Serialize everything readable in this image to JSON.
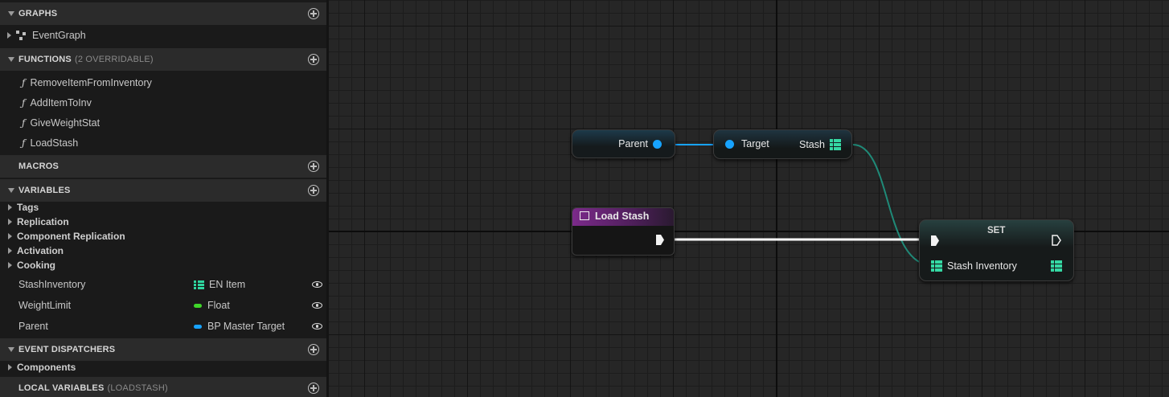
{
  "panel": {
    "graphs": {
      "title": "GRAPHS",
      "items": [
        "EventGraph"
      ]
    },
    "functions": {
      "title": "FUNCTIONS",
      "subtitle": "(2 OVERRIDABLE)",
      "items": [
        "RemoveItemFromInventory",
        "AddItemToInv",
        "GiveWeightStat",
        "LoadStash"
      ]
    },
    "macros": {
      "title": "MACROS"
    },
    "variables": {
      "title": "VARIABLES",
      "categories": [
        "Tags",
        "Replication",
        "Component Replication",
        "Activation",
        "Cooking"
      ],
      "items": [
        {
          "name": "StashInventory",
          "type": "EN Item",
          "type_icon": "array-grid-icon",
          "color": "#2fd7a0"
        },
        {
          "name": "WeightLimit",
          "type": "Float",
          "type_icon": "float-pill-icon",
          "color": "#3fd629"
        },
        {
          "name": "Parent",
          "type": "BP Master Target",
          "type_icon": "object-pill-icon",
          "color": "#17a3ff"
        }
      ]
    },
    "dispatchers": {
      "title": "EVENT DISPATCHERS",
      "items": [
        "Components"
      ]
    },
    "local_variables": {
      "title": "LOCAL VARIABLES",
      "subtitle": "(LOADSTASH)"
    }
  },
  "graph": {
    "nodes": {
      "parent_getter": {
        "pin": "Parent"
      },
      "stash_getter": {
        "input_pin": "Target",
        "output_pin": "Stash"
      },
      "load_stash_entry": {
        "title": "Load Stash",
        "header_color": "#7b2a8a"
      },
      "set_node": {
        "title": "SET",
        "input_pin": "Stash Inventory"
      }
    },
    "colors": {
      "object_wire": "#17a3ff",
      "array_wire": "#1f8a78",
      "exec_wire": "#ffffff"
    }
  }
}
